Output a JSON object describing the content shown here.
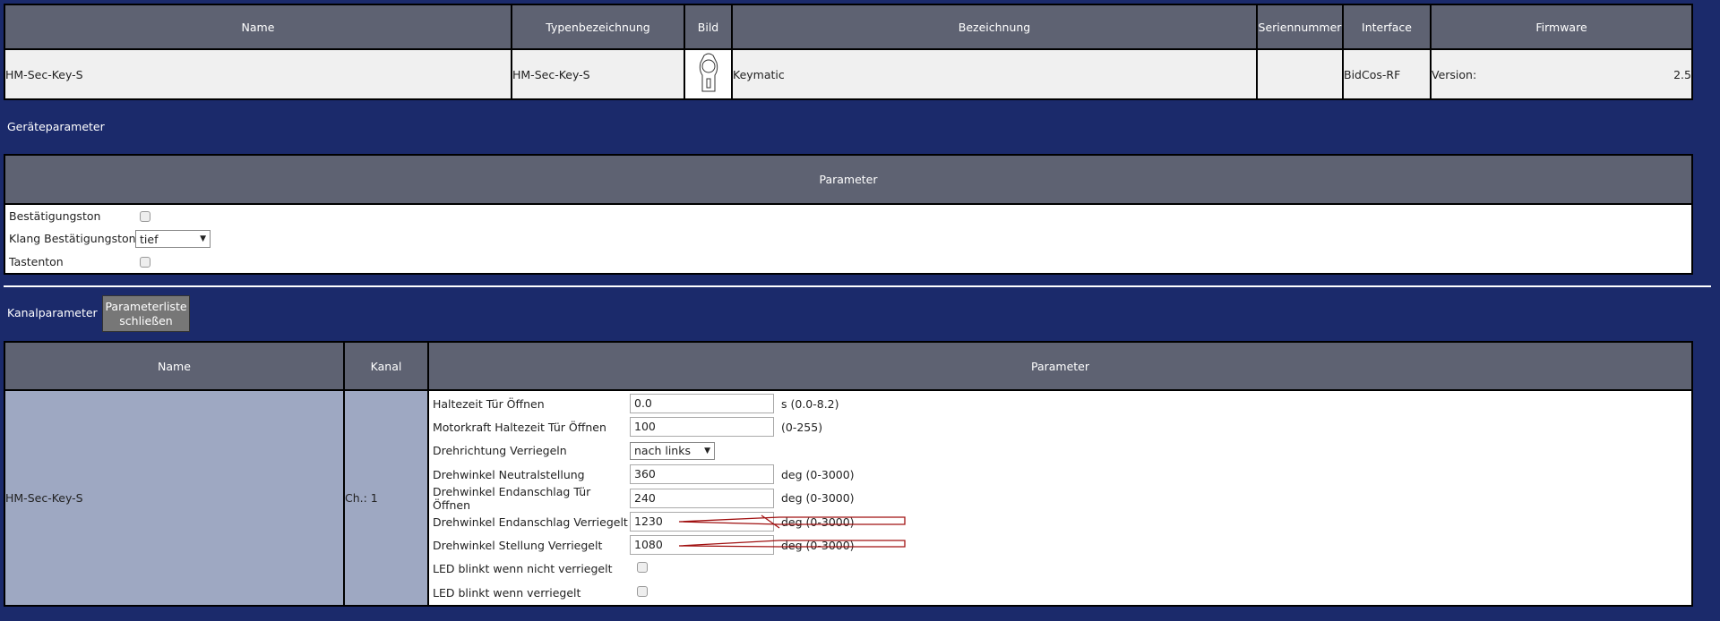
{
  "device_table": {
    "headers": [
      "Name",
      "Typenbezeichnung",
      "Bild",
      "Bezeichnung",
      "Seriennummer",
      "Interface",
      "Firmware"
    ],
    "row": {
      "name": "HM-Sec-Key-S",
      "type": "HM-Sec-Key-S",
      "description": "Keymatic",
      "serial": "",
      "interface": "BidCos-RF",
      "firmware_label": "Version:",
      "firmware_value": "2.5"
    }
  },
  "device_params": {
    "title": "Geräteparameter",
    "header": "Parameter",
    "items": [
      {
        "label": "Bestätigungston",
        "kind": "checkbox"
      },
      {
        "label": "Klang Bestätigungston",
        "kind": "select",
        "value": "tief"
      },
      {
        "label": "Tastenton",
        "kind": "checkbox"
      }
    ]
  },
  "channel_params": {
    "title": "Kanalparameter",
    "close_button": "Parameterliste schließen",
    "headers": [
      "Name",
      "Kanal",
      "Parameter"
    ],
    "name": "HM-Sec-Key-S",
    "channel": "Ch.: 1",
    "items": [
      {
        "label": "Haltezeit Tür Öffnen",
        "kind": "input",
        "value": "0.0",
        "unit": "s (0.0-8.2)"
      },
      {
        "label": "Motorkraft Haltezeit Tür Öffnen",
        "kind": "input",
        "value": "100",
        "unit": "(0-255)"
      },
      {
        "label": "Drehrichtung Verriegeln",
        "kind": "select",
        "value": "nach links"
      },
      {
        "label": "Drehwinkel Neutralstellung",
        "kind": "input",
        "value": "360",
        "unit": "deg (0-3000)"
      },
      {
        "label": "Drehwinkel Endanschlag Tür Öffnen",
        "kind": "input",
        "value": "240",
        "unit": "deg (0-3000)"
      },
      {
        "label": "Drehwinkel Endanschlag Verriegelt",
        "kind": "input",
        "value": "1230",
        "unit": "deg (0-3000)"
      },
      {
        "label": "Drehwinkel Stellung Verriegelt",
        "kind": "input",
        "value": "1080",
        "unit": "deg (0-3000)"
      },
      {
        "label": "LED blinkt wenn nicht verriegelt",
        "kind": "checkbox"
      },
      {
        "label": "LED blinkt wenn verriegelt",
        "kind": "checkbox"
      }
    ]
  },
  "colors": {
    "background": "#1b2a6b",
    "header": "#5e6272",
    "annotation": "#a01010"
  }
}
